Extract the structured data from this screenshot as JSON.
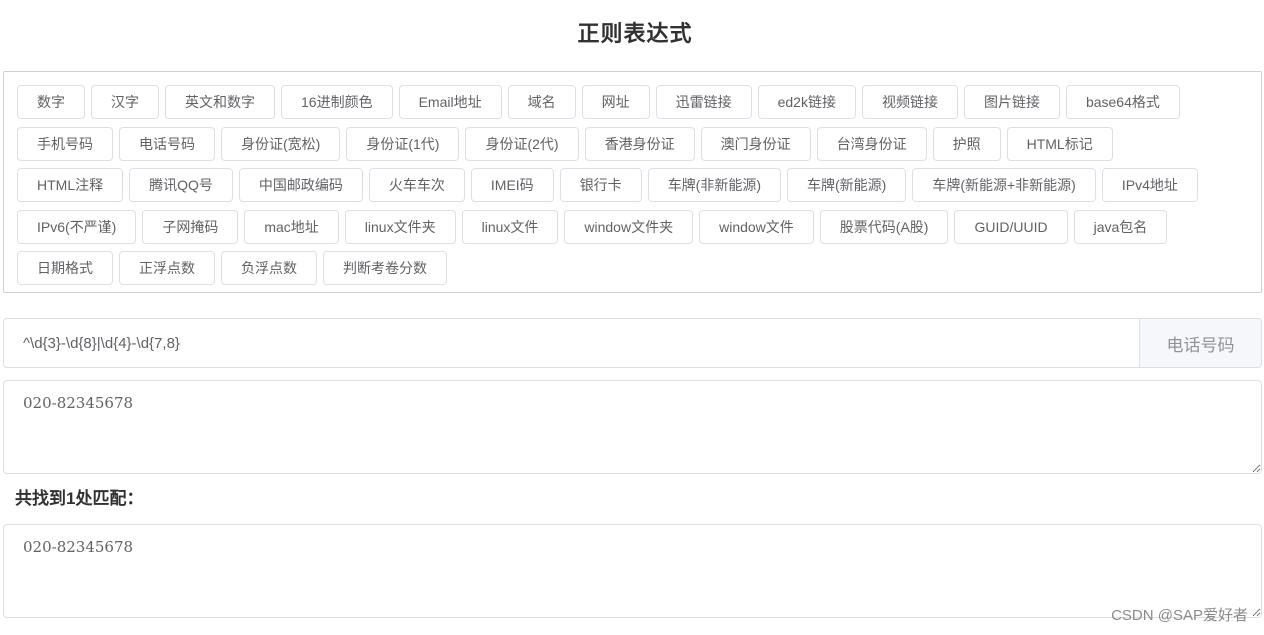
{
  "page": {
    "title": "正则表达式"
  },
  "buttons": {
    "rows": [
      [
        "数字",
        "汉字",
        "英文和数字",
        "16进制颜色",
        "Email地址",
        "域名",
        "网址",
        "迅雷链接",
        "ed2k链接",
        "视频链接",
        "图片链接",
        "base64格式"
      ],
      [
        "手机号码",
        "电话号码",
        "身份证(宽松)",
        "身份证(1代)",
        "身份证(2代)",
        "香港身份证",
        "澳门身份证",
        "台湾身份证",
        "护照",
        "HTML标记"
      ],
      [
        "HTML注释",
        "腾讯QQ号",
        "中国邮政编码",
        "火车车次",
        "IMEI码",
        "银行卡",
        "车牌(非新能源)",
        "车牌(新能源)",
        "车牌(新能源+非新能源)",
        "IPv4地址"
      ],
      [
        "IPv6(不严谨)",
        "子网掩码",
        "mac地址",
        "linux文件夹",
        "linux文件",
        "window文件夹",
        "window文件",
        "股票代码(A股)",
        "GUID/UUID",
        "java包名"
      ],
      [
        "日期格式",
        "正浮点数",
        "负浮点数",
        "判断考卷分数"
      ]
    ]
  },
  "regex": {
    "value": "^\\d{3}-\\d{8}|\\d{4}-\\d{7,8}",
    "append_label": "电话号码"
  },
  "source_text": {
    "value": "020-82345678"
  },
  "result": {
    "label": "共找到1处匹配：",
    "value": "020-82345678"
  },
  "watermark": "CSDN @SAP爱好者"
}
